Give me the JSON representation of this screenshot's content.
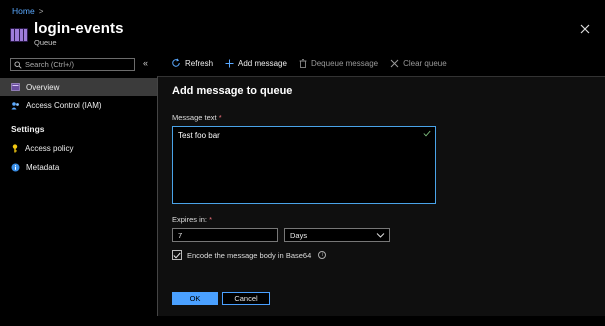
{
  "breadcrumb": {
    "home": "Home",
    "separator": ">"
  },
  "header": {
    "title": "login-events",
    "subtitle": "Queue"
  },
  "sidebar": {
    "search_placeholder": "Search (Ctrl+/)",
    "collapse": "«",
    "items": [
      {
        "label": "Overview",
        "icon": "overview-icon",
        "active": true
      },
      {
        "label": "Access Control (IAM)",
        "icon": "iam-icon",
        "active": false
      }
    ],
    "settings_label": "Settings",
    "settings_items": [
      {
        "label": "Access policy",
        "icon": "key-icon"
      },
      {
        "label": "Metadata",
        "icon": "info-icon"
      }
    ]
  },
  "toolbar": {
    "refresh": "Refresh",
    "add_message": "Add message",
    "dequeue_message": "Dequeue message",
    "clear_queue": "Clear queue"
  },
  "panel": {
    "title": "Add message to queue",
    "message_label": "Message text",
    "required_mark": "*",
    "message_value": "Test foo bar",
    "expires_label": "Expires in:",
    "expires_value": "7",
    "expires_unit": "Days",
    "encode_label": "Encode the message body in Base64",
    "encode_checked": true,
    "ok_label": "OK",
    "cancel_label": "Cancel"
  },
  "colors": {
    "accent": "#4aa0ff",
    "background": "#000000",
    "panel": "#0f0f0f",
    "required": "#f1707b"
  }
}
